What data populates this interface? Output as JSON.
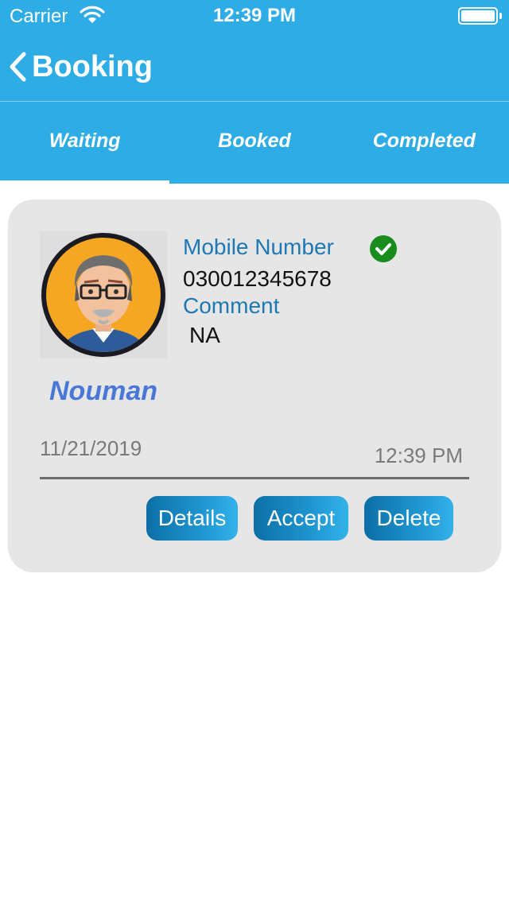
{
  "status_bar": {
    "carrier": "Carrier",
    "time": "12:39 PM"
  },
  "nav": {
    "title": "Booking",
    "back_icon": "chevron-left-icon"
  },
  "tabs": [
    {
      "label": "Waiting",
      "active": true
    },
    {
      "label": "Booked",
      "active": false
    },
    {
      "label": "Completed",
      "active": false
    }
  ],
  "booking": {
    "name": "Nouman",
    "mobile_label": "Mobile Number",
    "mobile_value": "030012345678",
    "verified_icon": "check-circle-icon",
    "comment_label": "Comment",
    "comment_value": "NA",
    "date": "11/21/2019",
    "time": "12:39 PM",
    "buttons": {
      "details": "Details",
      "accept": "Accept",
      "delete": "Delete"
    }
  },
  "colors": {
    "header": "#2DACE6",
    "label": "#1E78B4",
    "name": "#4A78D8",
    "verified": "#198C1E",
    "card": "#E6E6E6"
  }
}
